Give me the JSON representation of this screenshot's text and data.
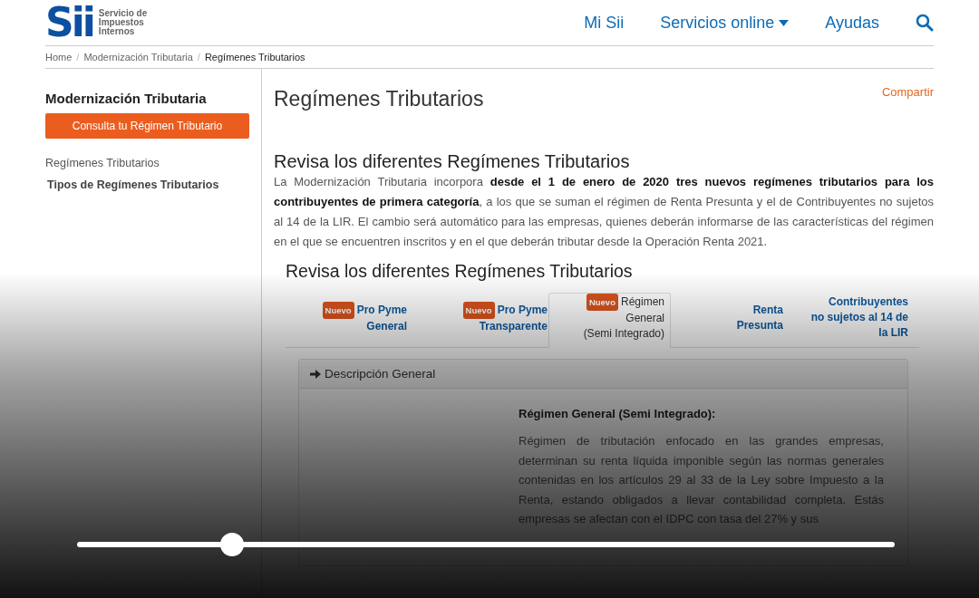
{
  "header": {
    "logo_mark": "Sii",
    "logo_text": "Servicio de\nImpuestos\nInternos",
    "nav": [
      {
        "label": "Mi Sii",
        "dropdown": false
      },
      {
        "label": "Servicios online",
        "dropdown": true
      },
      {
        "label": "Ayudas",
        "dropdown": false
      }
    ]
  },
  "breadcrumb": [
    {
      "kind": "link",
      "label": "Home",
      "current": false
    },
    {
      "kind": "separator",
      "label": "/"
    },
    {
      "kind": "link",
      "label": "Modernización Tributaria",
      "current": false
    },
    {
      "kind": "separator",
      "label": "/"
    },
    {
      "kind": "link",
      "label": "Regímenes Tributarios",
      "current": true
    }
  ],
  "sidebar": {
    "title": "Modernización Tributaria",
    "button": "Consulta tu Régimen Tributario",
    "items": [
      {
        "label": "Regímenes Tributarios",
        "selected": false
      },
      {
        "label": "Tipos de Regímenes Tributarios",
        "selected": true
      }
    ]
  },
  "main": {
    "title": "Regímenes Tributarios",
    "share": "Compartir",
    "section_title": "Revisa los diferentes Regímenes Tributarios",
    "intro": "La Modernización Tributaria incorpora **desde el 1 de enero de 2020 tres nuevos regímenes tributarios para los contribuyentes de primera categoría**, a los que se suman el régimen de Renta Presunta y el de Contribuyentes no sujetos al 14 de la LIR. El cambio será automático para las empresas, quienes deberán informarse de las características del régimen en el que se encuentren inscritos y en el que deberán tributar desde la Operación Renta 2021.",
    "tabs_title": "Revisa los diferentes Regímenes Tributarios",
    "tabs": [
      {
        "badge": "Nuevo",
        "label": "Pro Pyme\nGeneral",
        "selected": false
      },
      {
        "badge": "Nuevo",
        "label": "Pro Pyme\nTransparente",
        "selected": false
      },
      {
        "badge": "Nuevo",
        "label": "Régimen\nGeneral\n(Semi Integrado)",
        "selected": true
      },
      {
        "label": "Renta\nPresunta",
        "selected": false
      },
      {
        "label": "Contribuyentes\nno sujetos al 14 de\nla LIR",
        "selected": false
      }
    ],
    "panel": {
      "title": "Descripción General",
      "expanded": true,
      "heading": "Régimen General (Semi Integrado):",
      "body": "Régimen de tributación enfocado en las grandes empresas, determinan su renta líquida imponible según las normas generales contenidas en los artículos 29 al 33 de la Ley sobre Impuesto a la Renta, estando obligados a llevar contabilidad completa. Estás empresas se afectan con el IDPC con tasa del 27% y sus"
    }
  },
  "player": {
    "level": 0.19
  }
}
